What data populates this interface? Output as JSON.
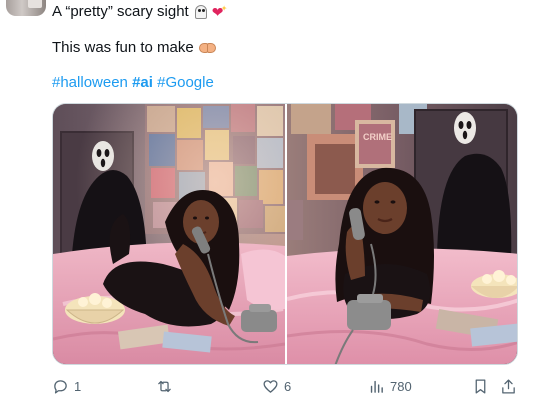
{
  "tweet": {
    "line1_text": "A “pretty” scary sight",
    "line1_emojis": [
      "ghost-emoji",
      "sparkling-heart-emoji"
    ],
    "line2_text": "This was fun to make",
    "line2_emoji": "heart-hands-emoji",
    "hashtags": [
      "#halloween",
      "#ai",
      "#Google"
    ]
  },
  "media": {
    "count": 2,
    "left_image": "AI image: woman in black lying on pink satin bed holding a rotary phone, masked ghost figure behind her",
    "right_image": "AI image: woman lying on pink satin bed holding a rotary phone, masked ghost figure at the door"
  },
  "actions": {
    "reply_count": "1",
    "retweet_count": "",
    "like_count": "6",
    "views_count": "780",
    "icons": [
      "reply-icon",
      "retweet-icon",
      "like-icon",
      "views-icon",
      "bookmark-icon",
      "share-icon"
    ]
  },
  "colors": {
    "hashtag": "#1d9bf0",
    "text": "#0f1419",
    "action": "#536471",
    "border": "#cfd9de"
  }
}
